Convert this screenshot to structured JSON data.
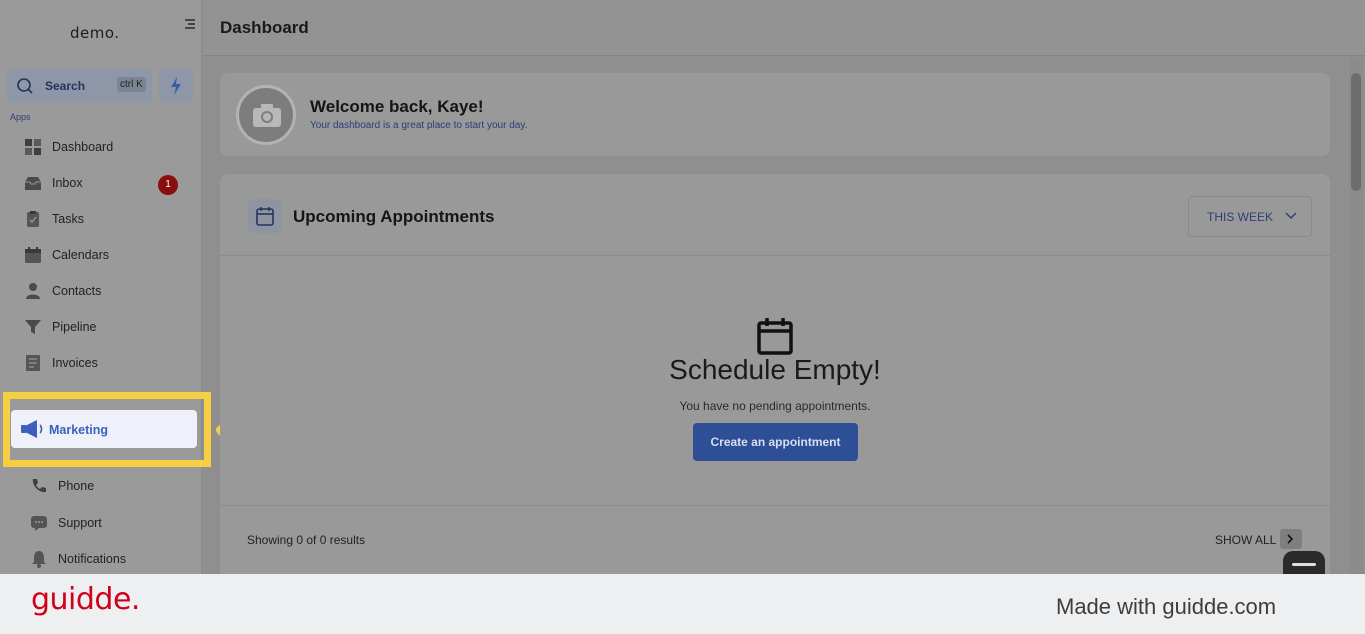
{
  "sidebar": {
    "logo": "demo.",
    "search_label": "Search",
    "search_shortcut": "ctrl K",
    "apps_label": "Apps",
    "items": [
      {
        "label": "Dashboard",
        "icon": "dashboard-icon"
      },
      {
        "label": "Inbox",
        "icon": "inbox-icon",
        "badge": "1"
      },
      {
        "label": "Tasks",
        "icon": "tasks-icon"
      },
      {
        "label": "Calendars",
        "icon": "calendar-icon"
      },
      {
        "label": "Contacts",
        "icon": "contacts-icon"
      },
      {
        "label": "Pipeline",
        "icon": "pipeline-icon"
      },
      {
        "label": "Invoices",
        "icon": "invoices-icon"
      },
      {
        "label": "Marketing",
        "icon": "megaphone-icon",
        "active": true
      },
      {
        "label": "Phone",
        "icon": "phone-icon"
      },
      {
        "label": "Support",
        "icon": "support-icon"
      },
      {
        "label": "Notifications",
        "icon": "bell-icon"
      }
    ]
  },
  "header": {
    "title": "Dashboard"
  },
  "welcome": {
    "title": "Welcome back, Kaye!",
    "subtitle": "Your dashboard is a great place to start your day."
  },
  "appointments": {
    "title": "Upcoming Appointments",
    "range_select": "THIS WEEK",
    "empty_title": "Schedule Empty!",
    "empty_subtitle": "You have no pending appointments.",
    "create_button": "Create an appointment",
    "results_text": "Showing 0 of 0 results",
    "show_all": "SHOW ALL"
  },
  "footer": {
    "brand": "guidde.",
    "made_with": "Made with guidde.com"
  },
  "colors": {
    "highlight": "#f7cf45",
    "accent": "#2e4f96",
    "brand_red": "#d0021b"
  }
}
